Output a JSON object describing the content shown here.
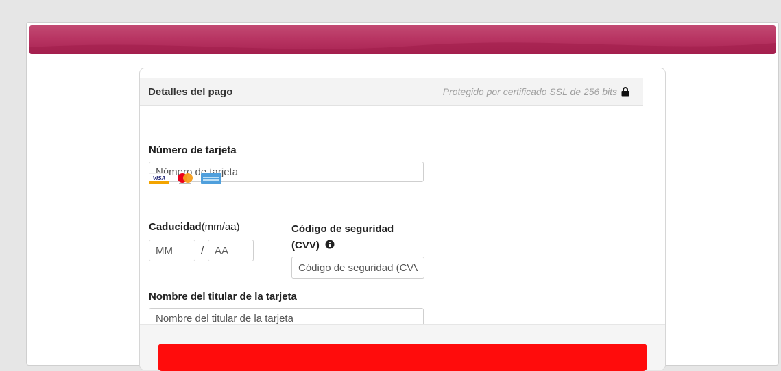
{
  "colors": {
    "banner": "#b83563",
    "submit": "#ff0c0c",
    "page_bg": "#e6e6e6"
  },
  "payment": {
    "title": "Detalles del pago",
    "ssl_note": "Protegido por certificado SSL de 256 bits",
    "card_number": {
      "label": "Número de tarjeta",
      "placeholder": "Número de tarjeta",
      "value": ""
    },
    "card_brands": [
      "visa-icon",
      "mastercard-icon",
      "amex-icon"
    ],
    "expiry": {
      "label": "Caducidad",
      "hint": "(mm/aa)",
      "month_placeholder": "MM",
      "separator": "/",
      "year_placeholder": "AA"
    },
    "cvv": {
      "label_line1": "Código de seguridad",
      "label_line2": "(CVV)",
      "placeholder": "Código de seguridad (CVV)",
      "icon": "info-icon"
    },
    "holder": {
      "label": "Nombre del titular de la tarjeta",
      "placeholder": "Nombre del titular de la tarjeta"
    },
    "submit_label": ""
  }
}
